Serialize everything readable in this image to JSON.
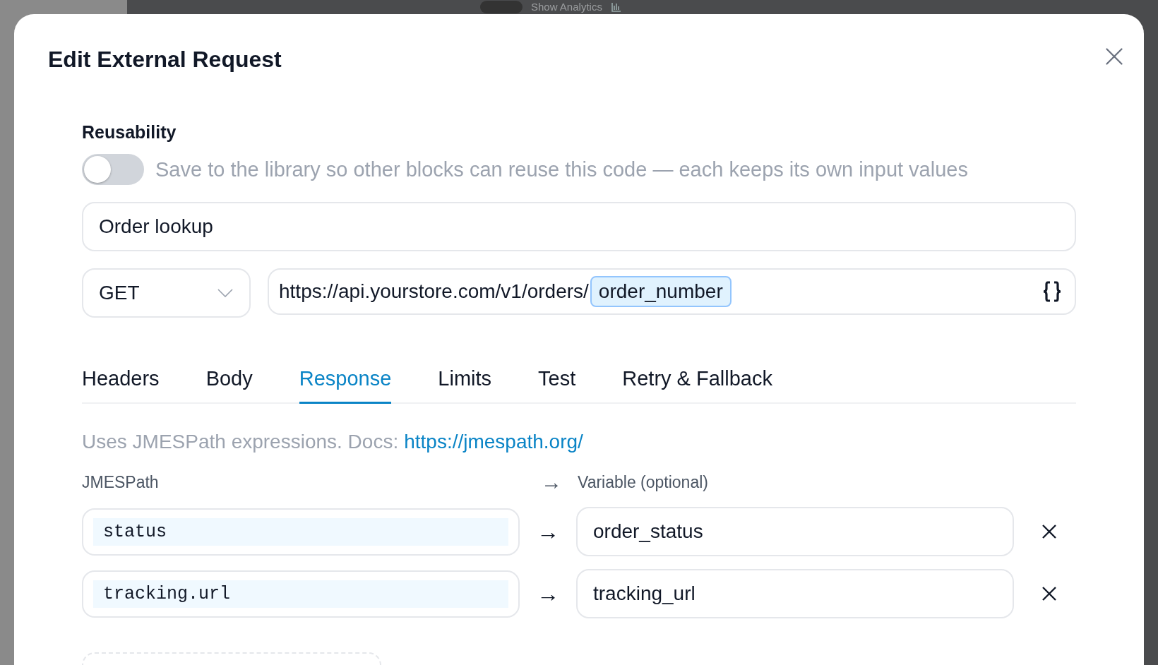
{
  "background": {
    "toolbar_label": "Show Analytics"
  },
  "dialog": {
    "title": "Edit External Request",
    "reusability": {
      "label": "Reusability",
      "on": false,
      "description": "Save to the library so other blocks can reuse this code — each keeps its own input values"
    },
    "name": {
      "value": "Order lookup"
    },
    "method": {
      "value": "GET"
    },
    "url": {
      "prefix": "https://api.yourstore.com/v1/orders/",
      "variable": "order_number"
    },
    "tabs": [
      {
        "label": "Headers",
        "selected": false
      },
      {
        "label": "Body",
        "selected": false
      },
      {
        "label": "Response",
        "selected": true
      },
      {
        "label": "Limits",
        "selected": false
      },
      {
        "label": "Test",
        "selected": false
      },
      {
        "label": "Retry & Fallback",
        "selected": false
      }
    ],
    "help": {
      "text": "Uses JMESPath expressions. Docs:",
      "link": "https://jmespath.org/"
    },
    "columns": {
      "path": "JMESPath",
      "arrow": "→",
      "variable": "Variable (optional)"
    },
    "mappings": [
      {
        "path": "status",
        "arrow": "→",
        "variable": "order_status"
      },
      {
        "path": "tracking.url",
        "arrow": "→",
        "variable": "tracking_url"
      }
    ]
  }
}
